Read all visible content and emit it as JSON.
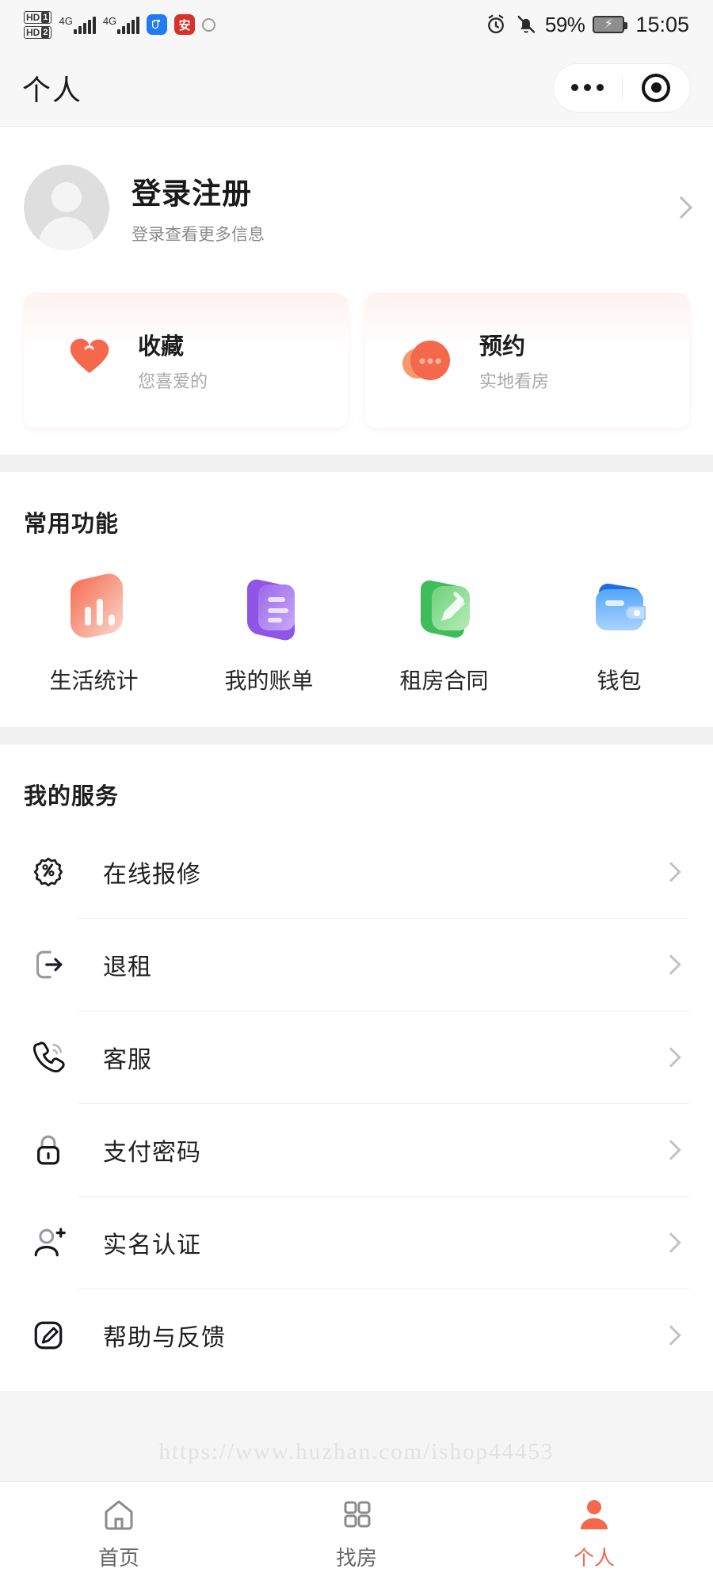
{
  "status_bar": {
    "hd_labels": [
      "HD 1",
      "HD 2"
    ],
    "network_labels": [
      "4G",
      "4G"
    ],
    "battery_percent": "59%",
    "time": "15:05",
    "icons": [
      "hd-1-icon",
      "hd-2-icon",
      "signal-4g-icon",
      "signal-4g-icon",
      "app-blue-icon",
      "app-red-icon",
      "sync-icon",
      "alarm-icon",
      "mute-bell-icon",
      "battery-charging-icon"
    ]
  },
  "header": {
    "title": "个人",
    "capsule": {
      "more_icon": "more-dots-icon",
      "target_icon": "target-circle-icon"
    }
  },
  "profile": {
    "avatar_icon": "default-avatar-icon",
    "title": "登录注册",
    "subtitle": "登录查看更多信息",
    "chevron_icon": "chevron-right-icon"
  },
  "quick_cards": [
    {
      "icon": "double-heart-icon",
      "title": "收藏",
      "subtitle": "您喜爱的",
      "color": "#f4684c"
    },
    {
      "icon": "chat-bubble-icon",
      "title": "预约",
      "subtitle": "实地看房",
      "color": "#f4684c"
    }
  ],
  "functions": {
    "section_title": "常用功能",
    "items": [
      {
        "icon": "bar-chart-icon",
        "label": "生活统计",
        "color": "#f4806b"
      },
      {
        "icon": "bill-document-icon",
        "label": "我的账单",
        "color": "#9b68e8"
      },
      {
        "icon": "contract-folder-icon",
        "label": "租房合同",
        "color": "#5fc46a"
      },
      {
        "icon": "wallet-icon",
        "label": "钱包",
        "color": "#3d8bf5"
      }
    ]
  },
  "services": {
    "section_title": "我的服务",
    "items": [
      {
        "icon": "repair-badge-icon",
        "label": "在线报修"
      },
      {
        "icon": "exit-lease-icon",
        "label": "退租"
      },
      {
        "icon": "phone-support-icon",
        "label": "客服"
      },
      {
        "icon": "lock-icon",
        "label": "支付密码"
      },
      {
        "icon": "user-verify-icon",
        "label": "实名认证"
      },
      {
        "icon": "feedback-edit-icon",
        "label": "帮助与反馈"
      }
    ],
    "chevron_icon": "chevron-right-icon"
  },
  "watermark": "https://www.huzhan.com/ishop44453",
  "tabbar": {
    "active_color": "#f4684c",
    "inactive_color": "#666666",
    "items": [
      {
        "icon": "home-icon",
        "label": "首页",
        "active": false
      },
      {
        "icon": "grid-search-icon",
        "label": "找房",
        "active": false
      },
      {
        "icon": "person-icon",
        "label": "个人",
        "active": true
      }
    ]
  }
}
